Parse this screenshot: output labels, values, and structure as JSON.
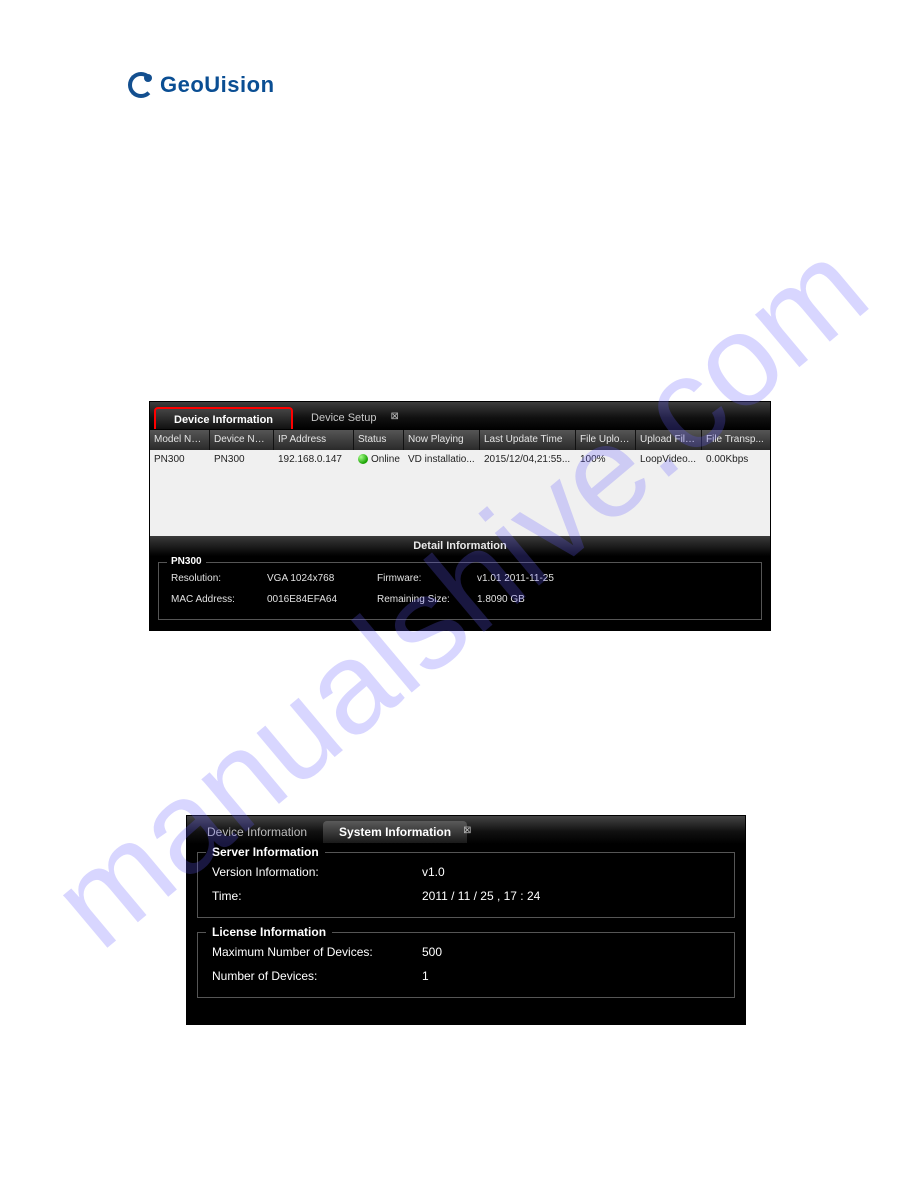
{
  "logo_text": "GeoUision",
  "watermark_text": "manualshive.com",
  "panel1": {
    "tabs": {
      "device_info": "Device Information",
      "device_setup": "Device Setup"
    },
    "columns": {
      "model": "Model Name",
      "device": "Device Name",
      "ip": "IP Address",
      "status": "Status",
      "now_playing": "Now Playing",
      "last_update": "Last Update Time",
      "file_upload_prog": "File Uploa...",
      "upload_file": "Upload File...",
      "file_transfer": "File Transp..."
    },
    "row": {
      "model": "PN300",
      "device": "PN300",
      "ip": "192.168.0.147",
      "status": "Online",
      "now_playing": "VD installatio...",
      "last_update": "2015/12/04,21:55...",
      "file_upload_prog": "100%",
      "upload_file": "LoopVideo...",
      "file_transfer": "0.00Kbps"
    },
    "detail_title": "Detail Information",
    "detail_legend": "PN300",
    "detail": {
      "resolution_k": "Resolution:",
      "resolution_v": "VGA 1024x768",
      "firmware_k": "Firmware:",
      "firmware_v": "v1.01 2011-11-25",
      "mac_k": "MAC Address:",
      "mac_v": "0016E84EFA64",
      "remaining_k": "Remaining Size:",
      "remaining_v": "1.8090 GB"
    }
  },
  "panel2": {
    "tabs": {
      "device_info": "Device Information",
      "system_info": "System Information"
    },
    "server_legend": "Server Information",
    "server": {
      "version_k": "Version Information:",
      "version_v": "v1.0",
      "time_k": "Time:",
      "time_v": "2011 / 11 / 25 , 17 : 24"
    },
    "license_legend": "License Information",
    "license": {
      "max_k": "Maximum Number of Devices:",
      "max_v": "500",
      "num_k": "Number of Devices:",
      "num_v": "1"
    }
  }
}
